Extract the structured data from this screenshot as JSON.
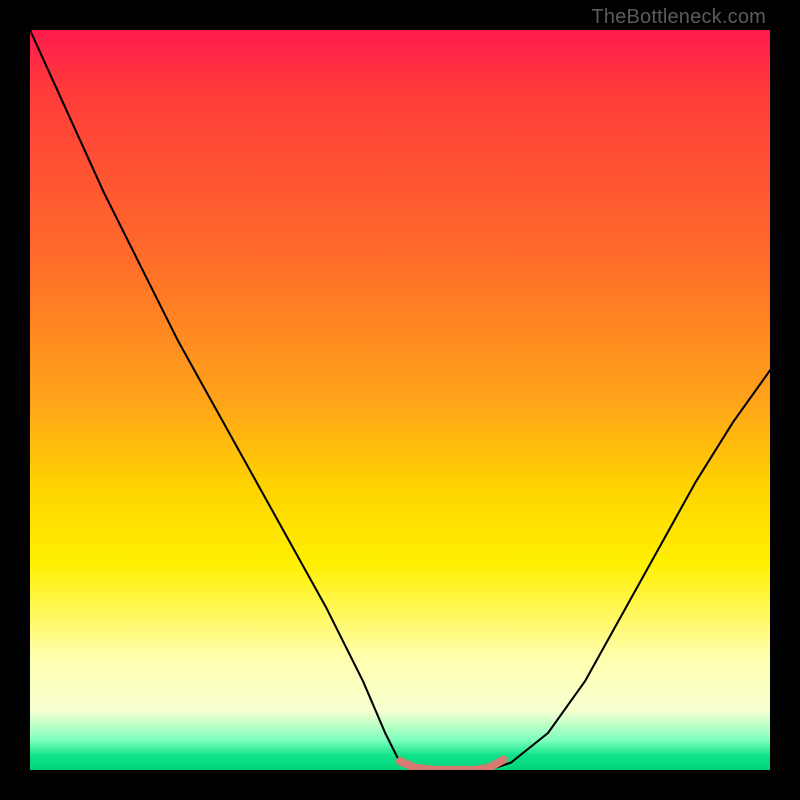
{
  "watermark": "TheBottleneck.com",
  "chart_data": {
    "type": "line",
    "title": "",
    "xlabel": "",
    "ylabel": "",
    "xlim": [
      0,
      100
    ],
    "ylim": [
      0,
      100
    ],
    "gradient_colors": {
      "top": "#ff1a4d",
      "mid_upper": "#ffa319",
      "mid": "#ffd400",
      "mid_lower": "#ffffb0",
      "bottom": "#00d47a"
    },
    "series": [
      {
        "name": "bottleneck-curve",
        "color": "#000000",
        "x": [
          0,
          5,
          10,
          15,
          20,
          25,
          30,
          35,
          40,
          45,
          48,
          50,
          52,
          55,
          58,
          60,
          62,
          65,
          70,
          75,
          80,
          85,
          90,
          95,
          100
        ],
        "y": [
          100,
          89,
          78,
          68,
          58,
          49,
          40,
          31,
          22,
          12,
          5,
          1,
          0,
          0,
          0,
          0,
          0,
          1,
          5,
          12,
          21,
          30,
          39,
          47,
          54
        ]
      },
      {
        "name": "flat-bottom-highlight",
        "color": "#d77b72",
        "x": [
          50,
          52,
          55,
          58,
          60,
          62,
          64
        ],
        "y": [
          1.2,
          0.3,
          0,
          0,
          0,
          0.3,
          1.4
        ]
      }
    ],
    "annotations": []
  }
}
